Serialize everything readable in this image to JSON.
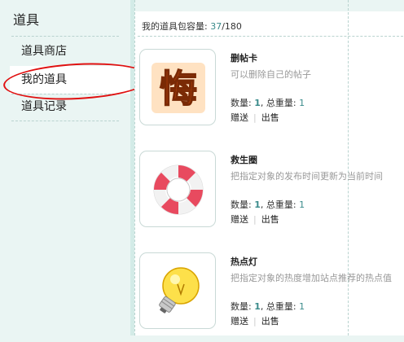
{
  "sidebar": {
    "title": "道具",
    "items": [
      {
        "label": "道具商店"
      },
      {
        "label": "我的道具"
      },
      {
        "label": "道具记录"
      }
    ]
  },
  "capacity": {
    "label": "我的道具包容量:",
    "used": "37",
    "total": "/180"
  },
  "items": [
    {
      "name": "删帖卡",
      "icon": "regret-icon",
      "description": "可以删除自己的帖子",
      "qty_label": "数量:",
      "qty": "1",
      "weight_label": ", 总重量:",
      "weight": "1",
      "gift": "赠送",
      "sell": "出售"
    },
    {
      "name": "救生圈",
      "icon": "lifebuoy-icon",
      "description": "把指定对象的发布时间更新为当前时间",
      "qty_label": "数量:",
      "qty": "1",
      "weight_label": ", 总重量:",
      "weight": "1",
      "gift": "赠送",
      "sell": "出售"
    },
    {
      "name": "热点灯",
      "icon": "light-bulb-icon",
      "description": "把指定对象的热度增加站点推荐的热点值",
      "qty_label": "数量:",
      "qty": "1",
      "weight_label": ", 总重量:",
      "weight": "1",
      "gift": "赠送",
      "sell": "出售"
    }
  ],
  "colors": {
    "sidebar_bg": "#eaf5f3",
    "accent_number": "#3a8b8b",
    "annotation_circle": "#e01010"
  }
}
